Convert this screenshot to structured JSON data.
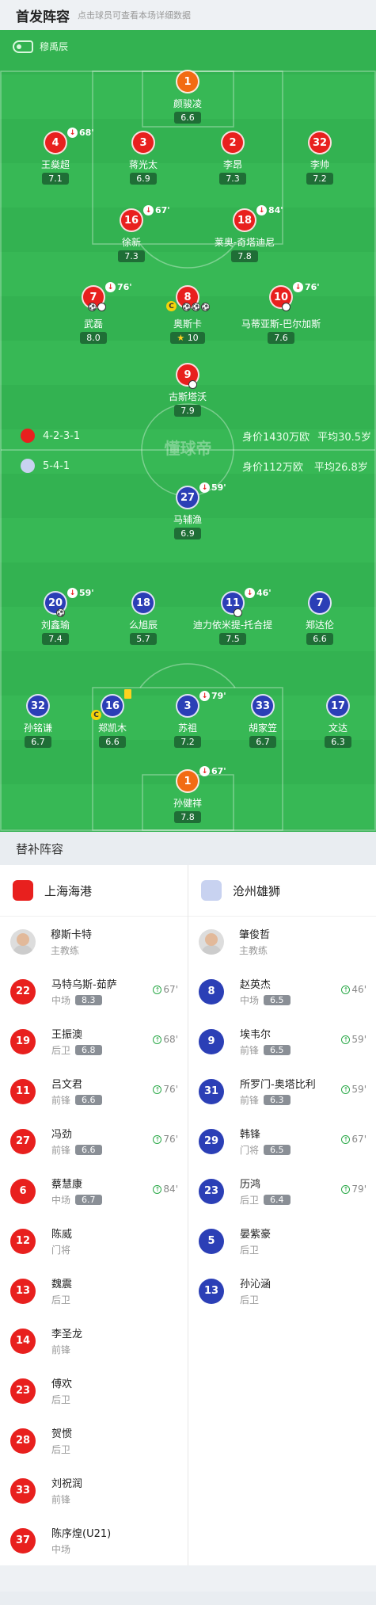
{
  "header": {
    "title": "首发阵容",
    "subtitle": "点击球员可查看本场详细数据"
  },
  "referee": "穆禹辰",
  "home_team": {
    "formation": "4-2-3-1",
    "value": "身价1430万欧",
    "avg_age": "平均30.5岁",
    "color": "#e8201e"
  },
  "away_team": {
    "formation": "5-4-1",
    "value": "身价112万欧",
    "avg_age": "平均26.8岁",
    "color": "#2b3fb6"
  },
  "watermark": "懂球帝",
  "home_players": [
    {
      "num": "1",
      "name": "颜骏凌",
      "rating": "6.6"
    },
    {
      "num": "4",
      "name": "王燊超",
      "rating": "7.1",
      "sub": "68'"
    },
    {
      "num": "3",
      "name": "蒋光太",
      "rating": "6.9"
    },
    {
      "num": "2",
      "name": "李昂",
      "rating": "7.3"
    },
    {
      "num": "32",
      "name": "李帅",
      "rating": "7.2"
    },
    {
      "num": "16",
      "name": "徐新",
      "rating": "7.3",
      "sub": "67'"
    },
    {
      "num": "18",
      "name": "莱奥-奇塔迪尼",
      "rating": "7.8",
      "sub": "84'"
    },
    {
      "num": "7",
      "name": "武磊",
      "rating": "8.0",
      "sub": "76'"
    },
    {
      "num": "8",
      "name": "奥斯卡",
      "rating": "10"
    },
    {
      "num": "10",
      "name": "马蒂亚斯-巴尔加斯",
      "rating": "7.6",
      "sub": "76'"
    },
    {
      "num": "9",
      "name": "古斯塔沃",
      "rating": "7.9"
    }
  ],
  "away_players": [
    {
      "num": "27",
      "name": "马辅渔",
      "rating": "6.9",
      "sub": "59'"
    },
    {
      "num": "20",
      "name": "刘鑫瑜",
      "rating": "7.4",
      "sub": "59'"
    },
    {
      "num": "18",
      "name": "么旭辰",
      "rating": "5.7"
    },
    {
      "num": "11",
      "name": "迪力依米提-托合提",
      "rating": "7.5",
      "sub": "46'"
    },
    {
      "num": "7",
      "name": "郑达伦",
      "rating": "6.6"
    },
    {
      "num": "32",
      "name": "孙铭谦",
      "rating": "6.7"
    },
    {
      "num": "16",
      "name": "郑凯木",
      "rating": "6.6"
    },
    {
      "num": "3",
      "name": "苏祖",
      "rating": "7.2",
      "sub": "79'"
    },
    {
      "num": "33",
      "name": "胡家笠",
      "rating": "6.7"
    },
    {
      "num": "17",
      "name": "文达",
      "rating": "6.3"
    },
    {
      "num": "1",
      "name": "孙健祥",
      "rating": "7.8",
      "sub": "67'"
    }
  ],
  "subs_title": "替补阵容",
  "home_subs": {
    "team_name": "上海海港",
    "coach": {
      "name": "穆斯卡特",
      "role": "主教练"
    },
    "players": [
      {
        "num": "22",
        "name": "马特乌斯-茹萨",
        "pos": "中场",
        "rating": "8.3",
        "min": "67'"
      },
      {
        "num": "19",
        "name": "王振澳",
        "pos": "后卫",
        "rating": "6.8",
        "min": "68'"
      },
      {
        "num": "11",
        "name": "吕文君",
        "pos": "前锋",
        "rating": "6.6",
        "min": "76'"
      },
      {
        "num": "27",
        "name": "冯劲",
        "pos": "前锋",
        "rating": "6.6",
        "min": "76'"
      },
      {
        "num": "6",
        "name": "蔡慧康",
        "pos": "中场",
        "rating": "6.7",
        "min": "84'"
      },
      {
        "num": "12",
        "name": "陈威",
        "pos": "门将"
      },
      {
        "num": "13",
        "name": "魏震",
        "pos": "后卫"
      },
      {
        "num": "14",
        "name": "李圣龙",
        "pos": "前锋"
      },
      {
        "num": "23",
        "name": "傅欢",
        "pos": "后卫"
      },
      {
        "num": "28",
        "name": "贺惯",
        "pos": "后卫"
      },
      {
        "num": "33",
        "name": "刘祝润",
        "pos": "前锋"
      },
      {
        "num": "37",
        "name": "陈序煌(U21)",
        "pos": "中场"
      }
    ]
  },
  "away_subs": {
    "team_name": "沧州雄狮",
    "coach": {
      "name": "肇俊哲",
      "role": "主教练"
    },
    "players": [
      {
        "num": "8",
        "name": "赵英杰",
        "pos": "中场",
        "rating": "6.5",
        "min": "46'"
      },
      {
        "num": "9",
        "name": "埃韦尔",
        "pos": "前锋",
        "rating": "6.5",
        "min": "59'"
      },
      {
        "num": "31",
        "name": "所罗门-奥塔比利",
        "pos": "前锋",
        "rating": "6.3",
        "min": "59'"
      },
      {
        "num": "29",
        "name": "韩锋",
        "pos": "门将",
        "rating": "6.5",
        "min": "67'"
      },
      {
        "num": "23",
        "name": "历鸿",
        "pos": "后卫",
        "rating": "6.4",
        "min": "79'"
      },
      {
        "num": "5",
        "name": "晏紫豪",
        "pos": "后卫"
      },
      {
        "num": "13",
        "name": "孙沁涵",
        "pos": "后卫"
      }
    ]
  }
}
